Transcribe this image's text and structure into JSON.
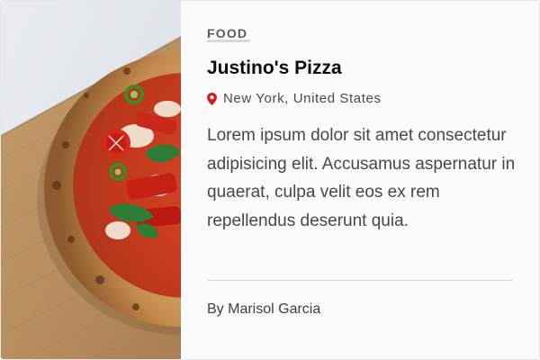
{
  "card": {
    "category": "FOOD",
    "title": "Justino's Pizza",
    "location": "New York, United States",
    "description": "Lorem ipsum dolor sit amet consectetur adipisicing elit. Accusamus aspernatur in quaerat, culpa velit eos ex rem repellendus deserunt quia.",
    "author": "By Marisol Garcia"
  },
  "icons": {
    "location": "map-pin-icon"
  },
  "colors": {
    "pin": "#d0201b",
    "title": "#0b0b0d",
    "body_text": "#47474d",
    "background": "#fbfafd"
  }
}
